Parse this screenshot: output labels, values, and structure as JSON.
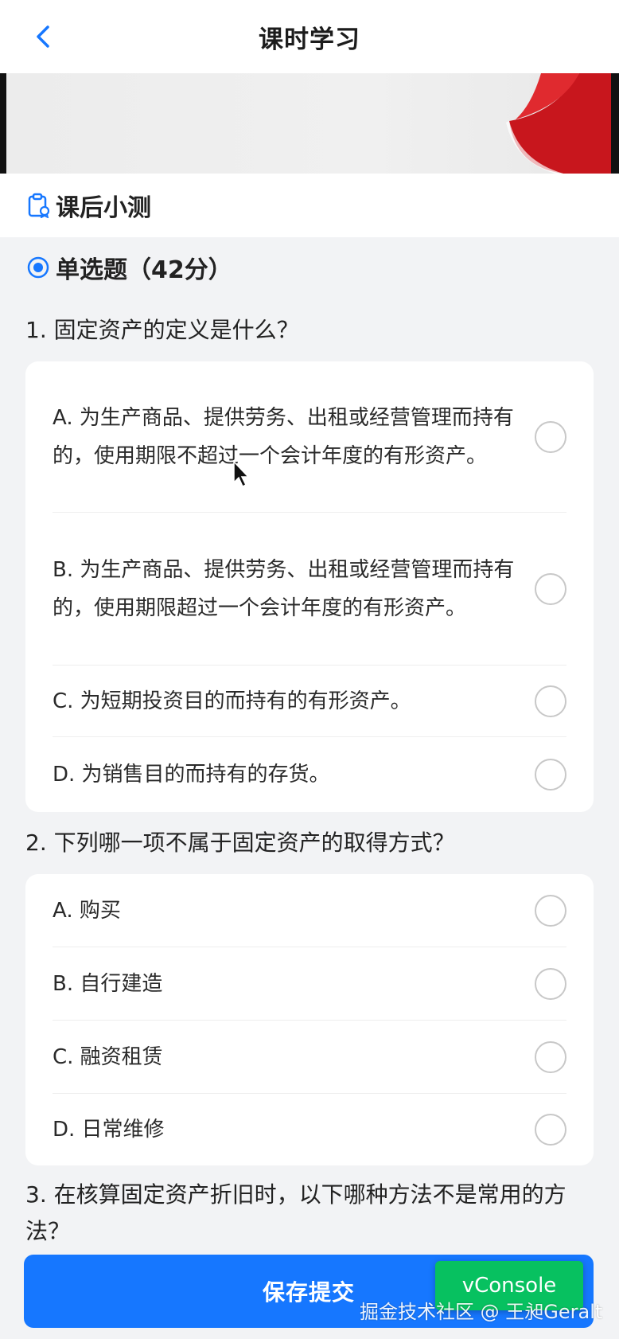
{
  "nav": {
    "title": "课时学习",
    "back_icon": "chevron-left-icon"
  },
  "section": {
    "title": "课后小测",
    "icon": "clipboard-icon"
  },
  "question_type": {
    "label": "单选题（42分）",
    "icon": "radio-selected-icon"
  },
  "questions": [
    {
      "text": "1. 固定资产的定义是什么？",
      "options": [
        {
          "text": "A. 为生产商品、提供劳务、出租或经营管理而持有的，使用期限不超过一个会计年度的有形资产。"
        },
        {
          "text": "B. 为生产商品、提供劳务、出租或经营管理而持有的，使用期限超过一个会计年度的有形资产。"
        },
        {
          "text": "C. 为短期投资目的而持有的有形资产。"
        },
        {
          "text": "D. 为销售目的而持有的存货。"
        }
      ]
    },
    {
      "text": "2. 下列哪一项不属于固定资产的取得方式？",
      "options": [
        {
          "text": "A. 购买"
        },
        {
          "text": "B. 自行建造"
        },
        {
          "text": "C. 融资租赁"
        },
        {
          "text": "D. 日常维修"
        }
      ]
    },
    {
      "text": "3. 在核算固定资产折旧时，以下哪种方法不是常用的方法？",
      "options": []
    }
  ],
  "footer": {
    "submit_label": "保存提交",
    "vconsole_label": "vConsole",
    "watermark": "掘金技术社区 @ 王昶Geralt"
  },
  "colors": {
    "accent": "#1677ff",
    "vconsole": "#07c160"
  }
}
